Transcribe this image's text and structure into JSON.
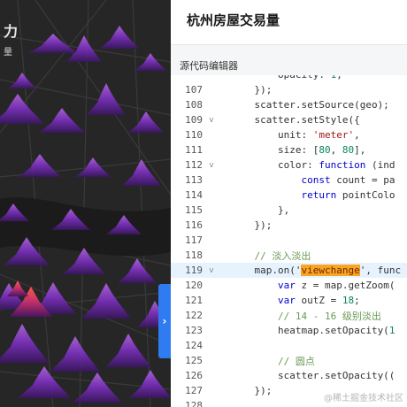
{
  "map": {
    "title_fragment": "力",
    "subtitle_fragment": "量",
    "toggle_icon": "›"
  },
  "panel": {
    "title": "杭州房屋交易量",
    "editor_label": "源代码编辑器"
  },
  "code_lines": [
    {
      "n": "107",
      "fold": "",
      "text": "    });"
    },
    {
      "n": "108",
      "fold": "",
      "text": "    scatter.setSource(geo);"
    },
    {
      "n": "109",
      "fold": "v",
      "text": "    scatter.setStyle({"
    },
    {
      "n": "110",
      "fold": "",
      "text": "        unit: 'meter',"
    },
    {
      "n": "111",
      "fold": "",
      "text": "        size: [80, 80],"
    },
    {
      "n": "112",
      "fold": "v",
      "text": "        color: function (ind"
    },
    {
      "n": "113",
      "fold": "",
      "text": "            const count = pa"
    },
    {
      "n": "114",
      "fold": "",
      "text": "            return pointColo"
    },
    {
      "n": "115",
      "fold": "",
      "text": "        },"
    },
    {
      "n": "116",
      "fold": "",
      "text": "    });"
    },
    {
      "n": "117",
      "fold": "",
      "text": ""
    },
    {
      "n": "118",
      "fold": "",
      "text": "    // 淡入淡出"
    },
    {
      "n": "119",
      "fold": "v",
      "text": "    map.on('viewchange', func"
    },
    {
      "n": "120",
      "fold": "",
      "text": "        var z = map.getZoom("
    },
    {
      "n": "121",
      "fold": "",
      "text": "        var outZ = 18;"
    },
    {
      "n": "122",
      "fold": "",
      "text": "        // 14 - 16 级别淡出"
    },
    {
      "n": "123",
      "fold": "",
      "text": "        heatmap.setOpacity(1"
    },
    {
      "n": "124",
      "fold": "",
      "text": ""
    },
    {
      "n": "125",
      "fold": "",
      "text": "        // 圆点"
    },
    {
      "n": "126",
      "fold": "",
      "text": "        scatter.setOpacity(("
    },
    {
      "n": "127",
      "fold": "",
      "text": "    });"
    },
    {
      "n": "128",
      "fold": "",
      "text": ""
    }
  ],
  "partial_top_line": "        opacity: 1,",
  "active_line": "119",
  "search_highlight": "viewchange",
  "watermark": "@稀土掘金技术社区",
  "colors": {
    "accent": "#2f7bf0",
    "highlight": "#f5a623",
    "peak_purple": "#7b2fbf",
    "peak_red": "#e8373a"
  }
}
